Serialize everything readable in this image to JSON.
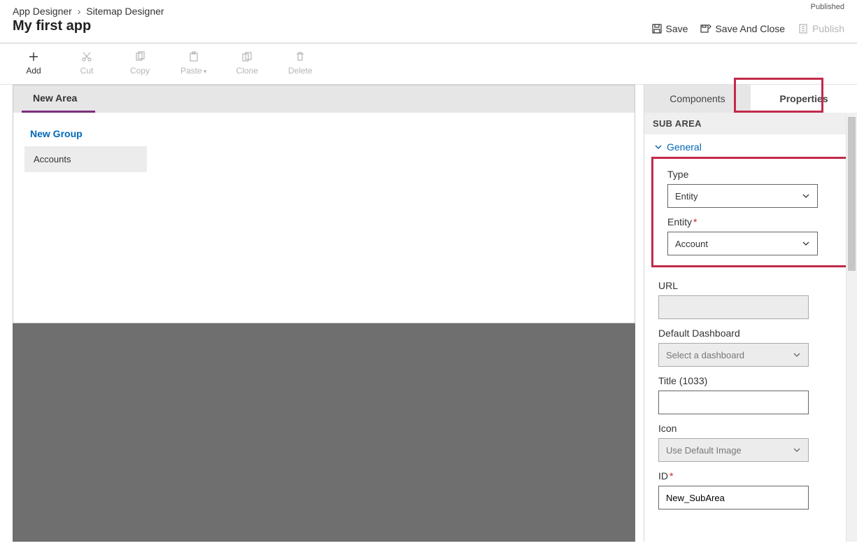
{
  "breadcrumb": {
    "a": "App Designer",
    "b": "Sitemap Designer"
  },
  "app_title": "My first app",
  "status": "Published",
  "header_actions": {
    "save": "Save",
    "save_close": "Save And Close",
    "publish": "Publish"
  },
  "toolbar": {
    "add": "Add",
    "cut": "Cut",
    "copy": "Copy",
    "paste": "Paste",
    "clone": "Clone",
    "delete": "Delete"
  },
  "canvas": {
    "area": "New Area",
    "group": "New Group",
    "subarea": "Accounts"
  },
  "tabs": {
    "components": "Components",
    "properties": "Properties"
  },
  "panel": {
    "section": "SUB AREA",
    "general": "General",
    "type_label": "Type",
    "type_value": "Entity",
    "entity_label": "Entity",
    "entity_value": "Account",
    "url_label": "URL",
    "url_value": "",
    "dashboard_label": "Default Dashboard",
    "dashboard_placeholder": "Select a dashboard",
    "title_label": "Title (1033)",
    "title_value": "",
    "icon_label": "Icon",
    "icon_value": "Use Default Image",
    "id_label": "ID",
    "id_value": "New_SubArea"
  }
}
